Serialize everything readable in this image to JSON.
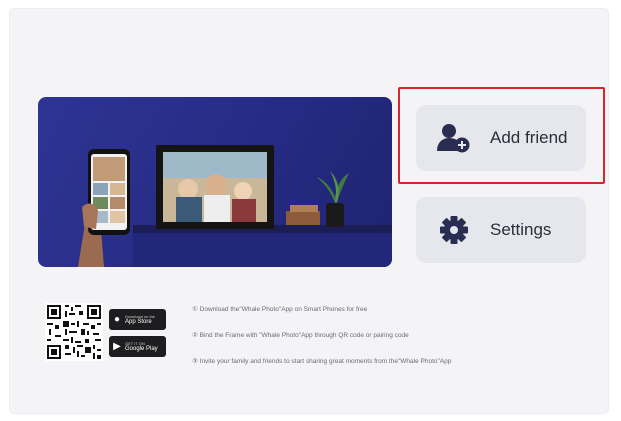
{
  "menu": {
    "add_friend_label": "Add friend",
    "settings_label": "Settings"
  },
  "app_badges": {
    "apple": {
      "small": "Download on the",
      "big": "App Store"
    },
    "google": {
      "small": "GET IT ON",
      "big": "Google Play"
    }
  },
  "steps": [
    "① Download the\"Whale Photo\"App on Smart Phones for free",
    "② Bind the Frame with \"Whale Photo\"App through QR code or pairing code",
    "③ Invite your family and friends to start sharing great moments from the\"Whale Photo\"App"
  ],
  "icons": {
    "add_friend": "add-person-icon",
    "settings": "gear-icon"
  },
  "colors": {
    "highlight_border": "#d3262e",
    "hero_background": "#2e3493",
    "button_background": "#e6e7ec",
    "icon_color": "#2a2d52"
  }
}
